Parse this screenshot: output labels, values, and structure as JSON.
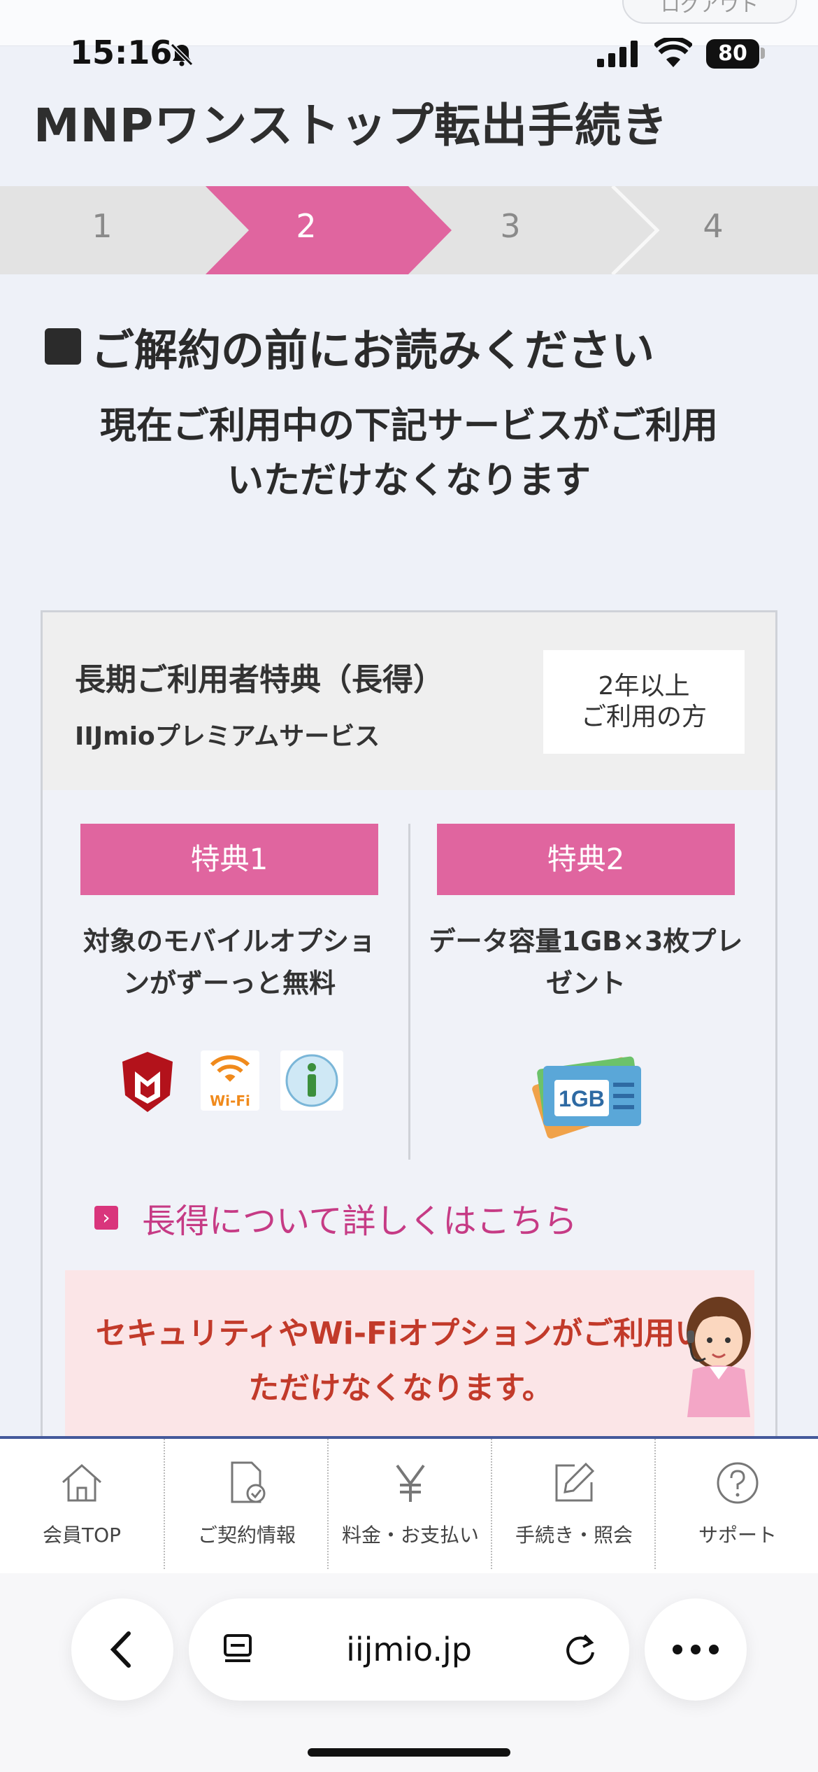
{
  "status_bar": {
    "time": "15:16",
    "battery": "80",
    "icons": [
      "bell-slash-icon",
      "signal-icon",
      "wifi-icon",
      "battery-icon"
    ]
  },
  "header": {
    "logout_label": "ログアウト",
    "page_title": "MNPワンストップ転出手続き"
  },
  "steps": {
    "items": [
      "1",
      "2",
      "3",
      "4"
    ],
    "current": "2",
    "active_color": "#e0659f"
  },
  "section": {
    "heading": "ご解約の前にお読みください",
    "notice_line1": "現在ご利用中の下記サービスがご利用",
    "notice_line2": "いただけなくなります"
  },
  "card": {
    "title": "長期ご利用者特典（長得）",
    "subtitle": "IIJmioプレミアムサービス",
    "requirement_line1": "2年以上",
    "requirement_line2": "ご利用の方",
    "benefits": [
      {
        "badge": "特典1",
        "desc_line1": "対象のモバイルオプショ",
        "desc_line2": "ンがずーっと無料",
        "icons": [
          "mcafee-icon",
          "wifi-option-icon",
          "i-filter-icon"
        ],
        "wifi_icon_text": "Wi-Fi"
      },
      {
        "badge": "特典2",
        "desc_line1": "データ容量1GB×3枚プレ",
        "desc_line2": "ゼント",
        "icons": [
          "data-cards-icon"
        ],
        "card_text": "1GB"
      }
    ],
    "more_link": "長得について詳しくはこちら",
    "warning_line1": "セキュリティやWi-Fiオプションがご利用い",
    "warning_line2": "ただけなくなります。"
  },
  "bottom_nav": {
    "items": [
      {
        "label": "会員TOP",
        "icon": "home-icon"
      },
      {
        "label": "ご契約情報",
        "icon": "contract-document-icon"
      },
      {
        "label": "料金・お支払い",
        "icon": "yen-icon"
      },
      {
        "label": "手続き・照会",
        "icon": "edit-icon"
      },
      {
        "label": "サポート",
        "icon": "help-icon"
      }
    ]
  },
  "browser": {
    "url": "iijmio.jp",
    "icons": [
      "back-icon",
      "tabs-icon",
      "reload-icon",
      "more-icon"
    ]
  },
  "colors": {
    "accent_pink": "#e0659f",
    "link_pink": "#c63b85",
    "warning_red": "#c23a2a",
    "nav_border": "#44599b"
  }
}
